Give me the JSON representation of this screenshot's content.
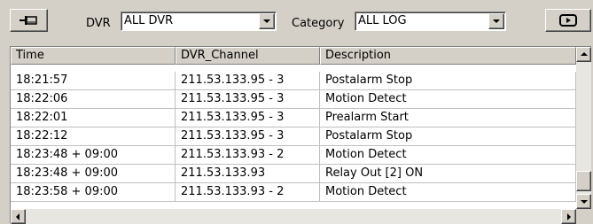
{
  "toolbar": {
    "pin_icon": "pin-icon",
    "dvr_label": "DVR",
    "dvr_value": "ALL DVR",
    "category_label": "Category",
    "category_value": "ALL LOG",
    "panel_icon": "panel-toggle-icon"
  },
  "log_table": {
    "columns": [
      "Time",
      "DVR_Channel",
      "Description"
    ],
    "rows": [
      [
        "18:21:57",
        "211.53.133.95 - 3",
        "Postalarm Stop"
      ],
      [
        "18:22:06",
        "211.53.133.95 - 3",
        "Motion Detect"
      ],
      [
        "18:22:01",
        "211.53.133.95 - 3",
        "Prealarm Start"
      ],
      [
        "18:22:12",
        "211.53.133.95 - 3",
        "Postalarm Stop"
      ],
      [
        "18:23:48 + 09:00",
        "211.53.133.93 - 2",
        "Motion Detect"
      ],
      [
        "18:23:48 + 09:00",
        "211.53.133.93",
        "Relay Out [2] ON"
      ],
      [
        "18:23:58 + 09:00",
        "211.53.133.93 - 2",
        "Motion Detect"
      ]
    ]
  },
  "scrollbars": {
    "vertical_position": 0.95,
    "horizontal_position": 0.0
  }
}
